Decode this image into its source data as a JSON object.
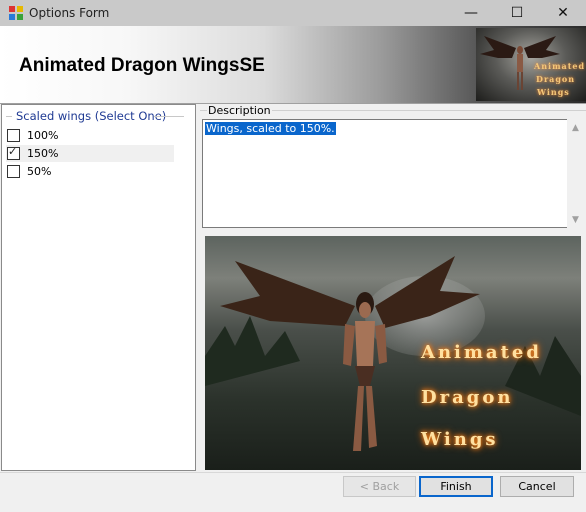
{
  "window": {
    "title": "Options Form",
    "minimize_glyph": "—",
    "maximize_glyph": "☐",
    "close_glyph": "✕"
  },
  "header": {
    "title": "Animated Dragon WingsSE",
    "thumb_lines": [
      "Animated",
      "Dragon",
      "Wings"
    ]
  },
  "options_group": {
    "legend": "Scaled wings (Select One)",
    "options": [
      {
        "label": "100%",
        "checked": false
      },
      {
        "label": "150%",
        "checked": true
      },
      {
        "label": "50%",
        "checked": false
      }
    ]
  },
  "description": {
    "legend": "Description",
    "text": "Wings, scaled to 150%."
  },
  "preview": {
    "lines": [
      "Animated",
      "Dragon",
      "Wings"
    ]
  },
  "buttons": {
    "back": "< Back",
    "finish": "Finish",
    "cancel": "Cancel"
  },
  "colors": {
    "accent": "#0a66cc",
    "legend_blue": "#1f3a93",
    "glow": "#ff8a1c"
  }
}
